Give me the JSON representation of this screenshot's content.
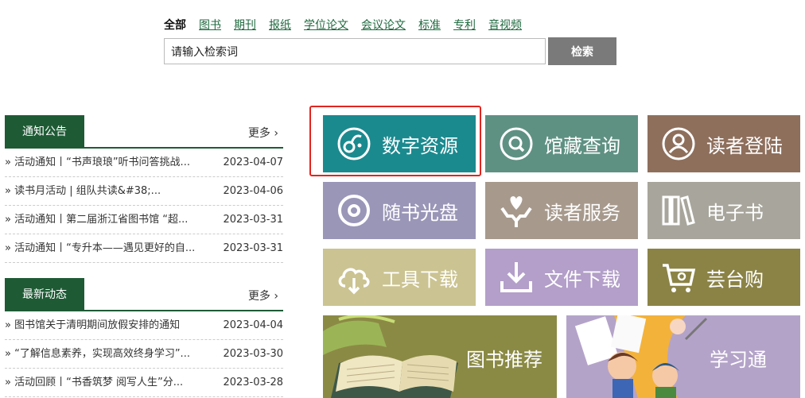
{
  "search": {
    "tabs": [
      "全部",
      "图书",
      "期刊",
      "报纸",
      "学位论文",
      "会议论文",
      "标准",
      "专利",
      "音视频"
    ],
    "placeholder": "请输入检索词",
    "button": "检索"
  },
  "notice": {
    "title": "通知公告",
    "more": "更多 ›",
    "items": [
      {
        "title": "» 活动通知丨“书声琅琅”听书问答挑战...",
        "date": "2023-04-07"
      },
      {
        "title": "» 读书月活动 | 组队共读&#38;...",
        "date": "2023-04-06"
      },
      {
        "title": "» 活动通知丨第二届浙江省图书馆 “超...",
        "date": "2023-03-31"
      },
      {
        "title": "» 活动通知丨“专升本——遇见更好的自...",
        "date": "2023-03-31"
      }
    ]
  },
  "news": {
    "title": "最新动态",
    "more": "更多 ›",
    "items": [
      {
        "title": "» 图书馆关于清明期间放假安排的通知",
        "date": "2023-04-04"
      },
      {
        "title": "» “了解信息素养，实现高效终身学习”...",
        "date": "2023-03-30"
      },
      {
        "title": "» 活动回顾丨“书香筑梦 阅写人生”分...",
        "date": "2023-03-28"
      }
    ]
  },
  "tiles": [
    {
      "label": "数字资源",
      "icon": "digital-resource-icon",
      "color": "#1b8a8f"
    },
    {
      "label": "馆藏查询",
      "icon": "search-icon",
      "color": "#5f9183"
    },
    {
      "label": "读者登陆",
      "icon": "user-icon",
      "color": "#8e6f5c"
    },
    {
      "label": "随书光盘",
      "icon": "disc-icon",
      "color": "#9a96b8"
    },
    {
      "label": "读者服务",
      "icon": "heart-hands-icon",
      "color": "#a79a8d"
    },
    {
      "label": "电子书",
      "icon": "books-icon",
      "color": "#a8a69c"
    },
    {
      "label": "工具下载",
      "icon": "cloud-download-icon",
      "color": "#cbc391"
    },
    {
      "label": "文件下载",
      "icon": "download-icon",
      "color": "#b39fc9"
    },
    {
      "label": "芸台购",
      "icon": "cart-icon",
      "color": "#8b8346"
    }
  ],
  "banners": [
    {
      "label": "图书推荐",
      "color": "#8b8a45"
    },
    {
      "label": "学习通",
      "color": "#b4a3c9"
    }
  ]
}
